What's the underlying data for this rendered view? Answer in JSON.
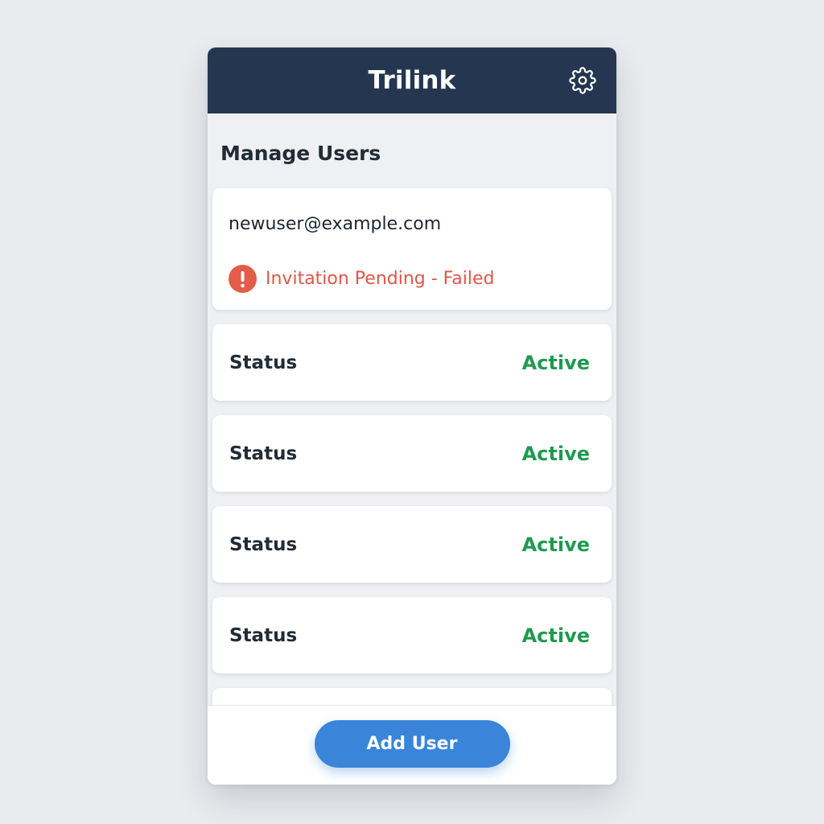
{
  "app": {
    "title": "Trilink",
    "settings_icon": "gear-icon"
  },
  "page": {
    "title": "Manage Users"
  },
  "invite": {
    "email": "newuser@example.com",
    "status_text": "Invitation Pending - Failed",
    "status_icon": "alert-icon",
    "status_color": "#e0564a"
  },
  "status_rows": [
    {
      "label": "Status",
      "value": "Active"
    },
    {
      "label": "Status",
      "value": "Active"
    },
    {
      "label": "Status",
      "value": "Active"
    },
    {
      "label": "Status",
      "value": "Active"
    }
  ],
  "footer": {
    "add_user_label": "Add User"
  },
  "colors": {
    "header_bg": "#243650",
    "accent": "#3a84da",
    "active": "#1f9a4f",
    "error": "#e35d4a"
  }
}
